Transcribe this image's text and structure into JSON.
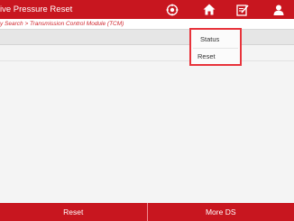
{
  "header": {
    "title": "ive Pressure Reset",
    "icons": [
      "settings-icon",
      "home-icon",
      "edit-icon",
      "user-icon"
    ]
  },
  "breadcrumb": "y Search > Transmission Control Module (TCM)",
  "dropdown": {
    "items": [
      "Status",
      "Reset"
    ]
  },
  "footer": {
    "reset_label": "Reset",
    "more_label": "More DS"
  },
  "colors": {
    "brand_red": "#c8161f",
    "highlight_red": "#e8333b",
    "breadcrumb_text": "#d0242c"
  }
}
